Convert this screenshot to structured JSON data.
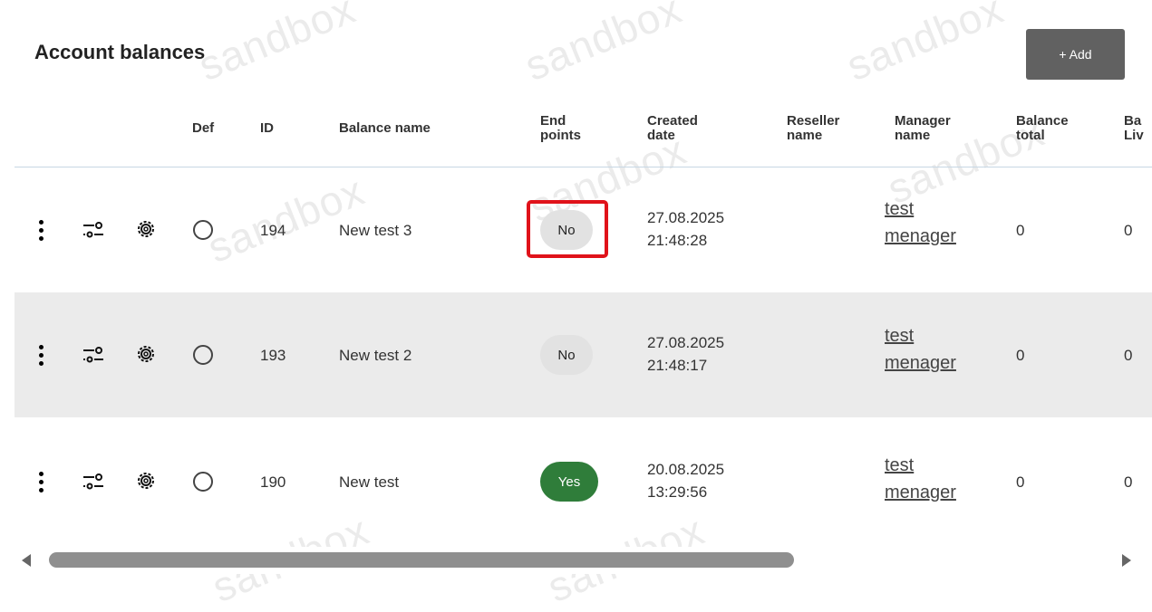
{
  "page": {
    "title": "Account balances",
    "add_label": "+ Add"
  },
  "watermark": "sandbox",
  "columns": [
    {
      "key": "def",
      "label": "Def"
    },
    {
      "key": "id",
      "label": "ID"
    },
    {
      "key": "balance_name",
      "label": "Balance name"
    },
    {
      "key": "end_points",
      "line1": "End",
      "line2": "points"
    },
    {
      "key": "created",
      "line1": "Created",
      "line2": "date"
    },
    {
      "key": "reseller",
      "line1": "Reseller",
      "line2": "name"
    },
    {
      "key": "manager",
      "line1": "Manager",
      "line2": "name"
    },
    {
      "key": "balance_total",
      "line1": "Balance",
      "line2": "total"
    },
    {
      "key": "balance_live",
      "line1": "Ba",
      "line2": "Liv"
    }
  ],
  "rows": [
    {
      "id": "194",
      "name": "New test 3",
      "end_points": "No",
      "date": "27.08.2025",
      "time": "21:48:28",
      "manager_line1": "test",
      "manager_line2": "menager",
      "total": "0",
      "live": "0"
    },
    {
      "id": "193",
      "name": "New test 2",
      "end_points": "No",
      "date": "27.08.2025",
      "time": "21:48:17",
      "manager_line1": "test",
      "manager_line2": "menager",
      "total": "0",
      "live": "0"
    },
    {
      "id": "190",
      "name": "New test",
      "end_points": "Yes",
      "date": "20.08.2025",
      "time": "13:29:56",
      "manager_line1": "test",
      "manager_line2": "menager",
      "total": "0",
      "live": "0"
    }
  ],
  "colors": {
    "yes_pill": "#2f7d3a",
    "no_pill": "#e2e2e2",
    "alt_row": "#ebebeb",
    "highlight": "#e0121a",
    "add_button": "#616161"
  },
  "icons": {
    "row_menu": "more-vertical-icon",
    "row_filter": "sliders-icon",
    "row_settings": "gear-icon",
    "default_radio": "radio-unchecked-icon"
  },
  "annotation": {
    "highlighted_cell": "rows.0.end_points"
  }
}
